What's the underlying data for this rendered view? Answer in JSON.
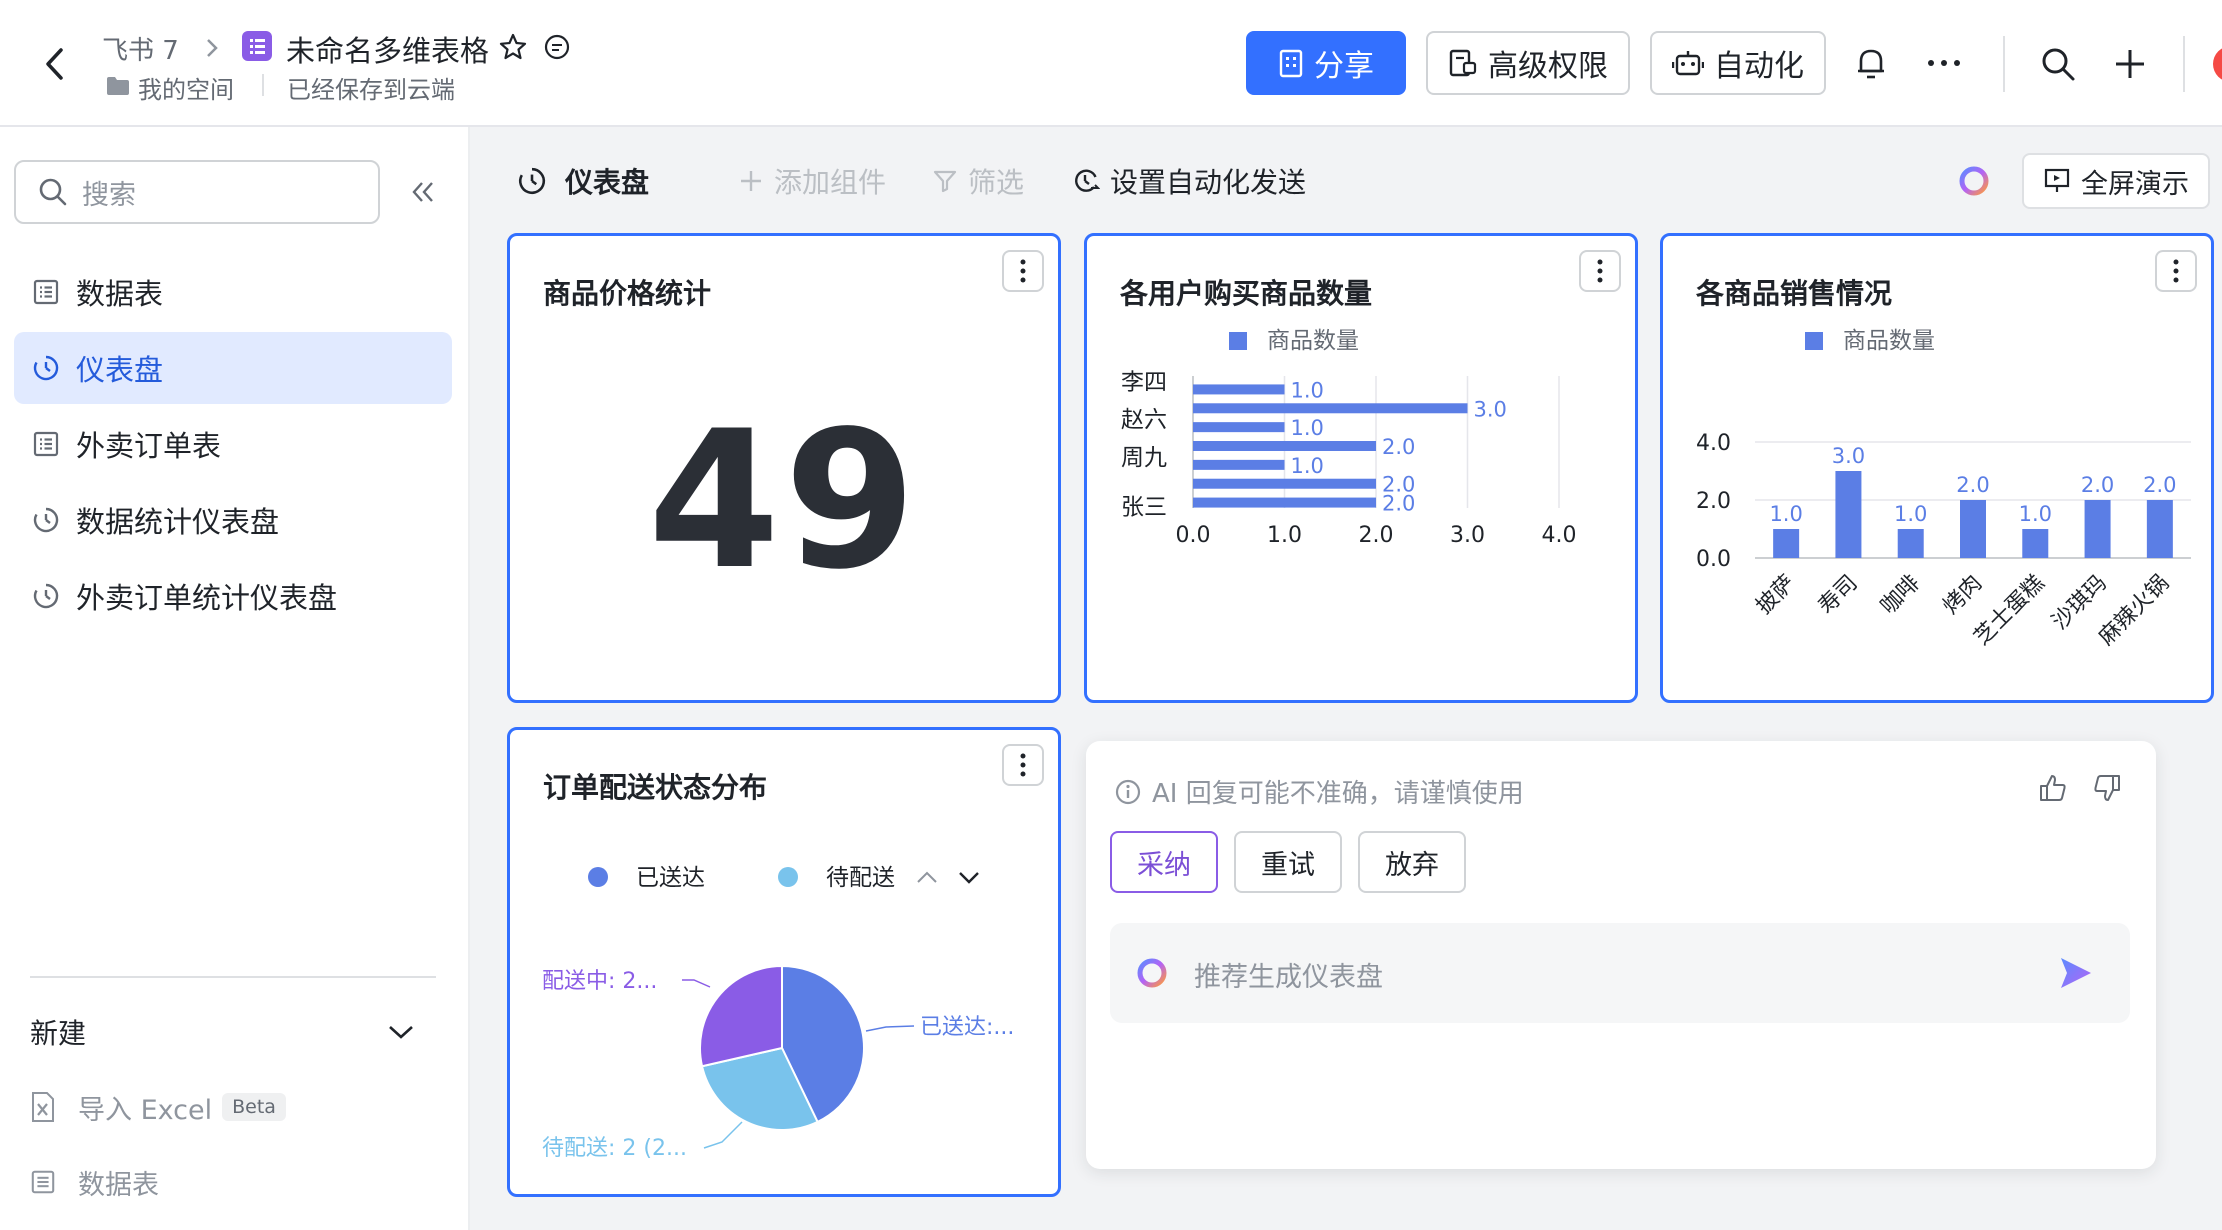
{
  "header": {
    "app_name": "飞书 7",
    "doc_title": "未命名多维表格",
    "folder": "我的空间",
    "save_status": "已经保存到云端",
    "share_label": "分享",
    "permission_label": "高级权限",
    "automation_label": "自动化"
  },
  "sidebar": {
    "search_placeholder": "搜索",
    "items": [
      {
        "label": "数据表",
        "icon": "table-icon"
      },
      {
        "label": "仪表盘",
        "icon": "dashboard-icon",
        "active": true
      },
      {
        "label": "外卖订单表",
        "icon": "table-icon"
      },
      {
        "label": "数据统计仪表盘",
        "icon": "dashboard-icon"
      },
      {
        "label": "外卖订单统计仪表盘",
        "icon": "dashboard-icon"
      }
    ],
    "new_label": "新建",
    "import_label": "导入 Excel",
    "beta_label": "Beta",
    "new_table_label": "数据表"
  },
  "toolbar": {
    "dashboard_label": "仪表盘",
    "add_widget_label": "添加组件",
    "filter_label": "筛选",
    "auto_send_label": "设置自动化发送",
    "fullscreen_label": "全屏演示"
  },
  "cards": {
    "price": {
      "title": "商品价格统计",
      "value": "49"
    },
    "user_qty": {
      "title": "各用户购买商品数量"
    },
    "product_sales": {
      "title": "各商品销售情况"
    },
    "delivery": {
      "title": "订单配送状态分布"
    }
  },
  "ai_panel": {
    "notice": "AI 回复可能不准确，请谨慎使用",
    "adopt_label": "采纳",
    "retry_label": "重试",
    "discard_label": "放弃",
    "input_placeholder": "推荐生成仪表盘"
  },
  "colors": {
    "accent": "#3370ff",
    "bar": "#5b7ee5",
    "pie_delivered": "#5b7ee5",
    "pie_pending": "#79c3ec",
    "pie_shipping": "#8a5ce6",
    "ai_purple": "#7b4fd6"
  },
  "chart_data": [
    {
      "type": "bar",
      "orientation": "horizontal",
      "title": "各用户购买商品数量",
      "legend": [
        "商品数量"
      ],
      "legend_position": "top",
      "categories_labeled": [
        "李四",
        "赵六",
        "周九",
        "张三"
      ],
      "series": [
        {
          "name": "商品数量",
          "values": [
            1.0,
            3.0,
            1.0,
            2.0,
            1.0,
            2.0,
            2.0
          ]
        }
      ],
      "xlim": [
        0,
        4
      ],
      "xticks": [
        "0.0",
        "1.0",
        "2.0",
        "3.0",
        "4.0"
      ],
      "grid": true
    },
    {
      "type": "bar",
      "title": "各商品销售情况",
      "legend": [
        "商品数量"
      ],
      "legend_position": "top",
      "categories": [
        "披萨",
        "寿司",
        "咖啡",
        "烤肉",
        "芝士蛋糕",
        "沙琪玛",
        "麻辣火锅"
      ],
      "series": [
        {
          "name": "商品数量",
          "values": [
            1.0,
            3.0,
            1.0,
            2.0,
            1.0,
            2.0,
            2.0
          ]
        }
      ],
      "ylim": [
        0,
        4
      ],
      "yticks": [
        "0.0",
        "2.0",
        "4.0"
      ],
      "grid": true
    },
    {
      "type": "pie",
      "title": "订单配送状态分布",
      "legend": [
        "已送达",
        "待配送"
      ],
      "legend_position": "top",
      "slices": [
        {
          "label": "已送达",
          "value": 3,
          "data_label": "已送达:..."
        },
        {
          "label": "待配送",
          "value": 2,
          "data_label": "待配送: 2 (2..."
        },
        {
          "label": "配送中",
          "value": 2,
          "data_label": "配送中: 2..."
        }
      ]
    }
  ]
}
